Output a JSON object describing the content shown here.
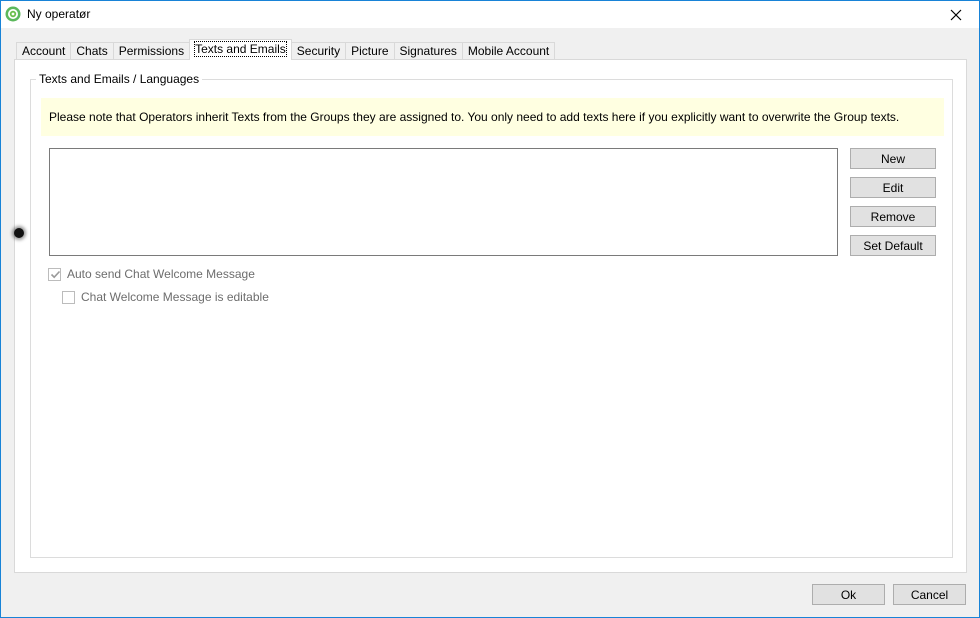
{
  "window": {
    "title": "Ny operatør",
    "accent": "#1883d7"
  },
  "tabs": [
    {
      "label": "Account",
      "active": false
    },
    {
      "label": "Chats",
      "active": false
    },
    {
      "label": "Permissions",
      "active": false
    },
    {
      "label": "Texts and Emails",
      "active": true
    },
    {
      "label": "Security",
      "active": false
    },
    {
      "label": "Picture",
      "active": false
    },
    {
      "label": "Signatures",
      "active": false
    },
    {
      "label": "Mobile Account",
      "active": false
    }
  ],
  "group": {
    "legend": "Texts and Emails / Languages",
    "notice": "Please note that Operators inherit Texts from the Groups they are assigned to. You only need to add texts here if you explicitly want to overwrite the Group texts.",
    "notice_bg": "#ffffe1",
    "buttons": {
      "new": "New",
      "edit": "Edit",
      "remove": "Remove",
      "set_default": "Set Default"
    },
    "checkboxes": {
      "auto_send": {
        "label": "Auto send Chat Welcome Message",
        "checked": true,
        "enabled": false
      },
      "editable": {
        "label": "Chat Welcome Message is editable",
        "checked": false,
        "enabled": false
      }
    }
  },
  "footer": {
    "ok": "Ok",
    "cancel": "Cancel"
  },
  "icons": {
    "app": "gear-icon",
    "close": "close-icon",
    "check": "checkmark-icon"
  }
}
